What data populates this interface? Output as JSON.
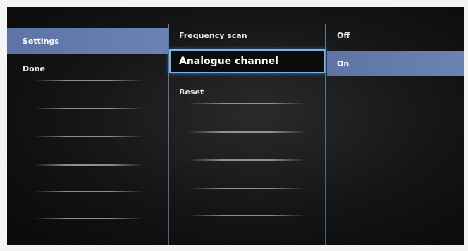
{
  "left_menu": {
    "items": [
      {
        "label": "Settings"
      },
      {
        "label": "Done"
      }
    ]
  },
  "middle_menu": {
    "items": [
      {
        "label": "Frequency scan"
      },
      {
        "label": "Analogue channel"
      },
      {
        "label": "Reset"
      }
    ]
  },
  "right_menu": {
    "items": [
      {
        "label": "Off"
      },
      {
        "label": "On"
      }
    ]
  },
  "colors": {
    "highlight": "#6a82b4",
    "focus_border": "#7fb0e6",
    "divider": "#6b8fb6"
  }
}
